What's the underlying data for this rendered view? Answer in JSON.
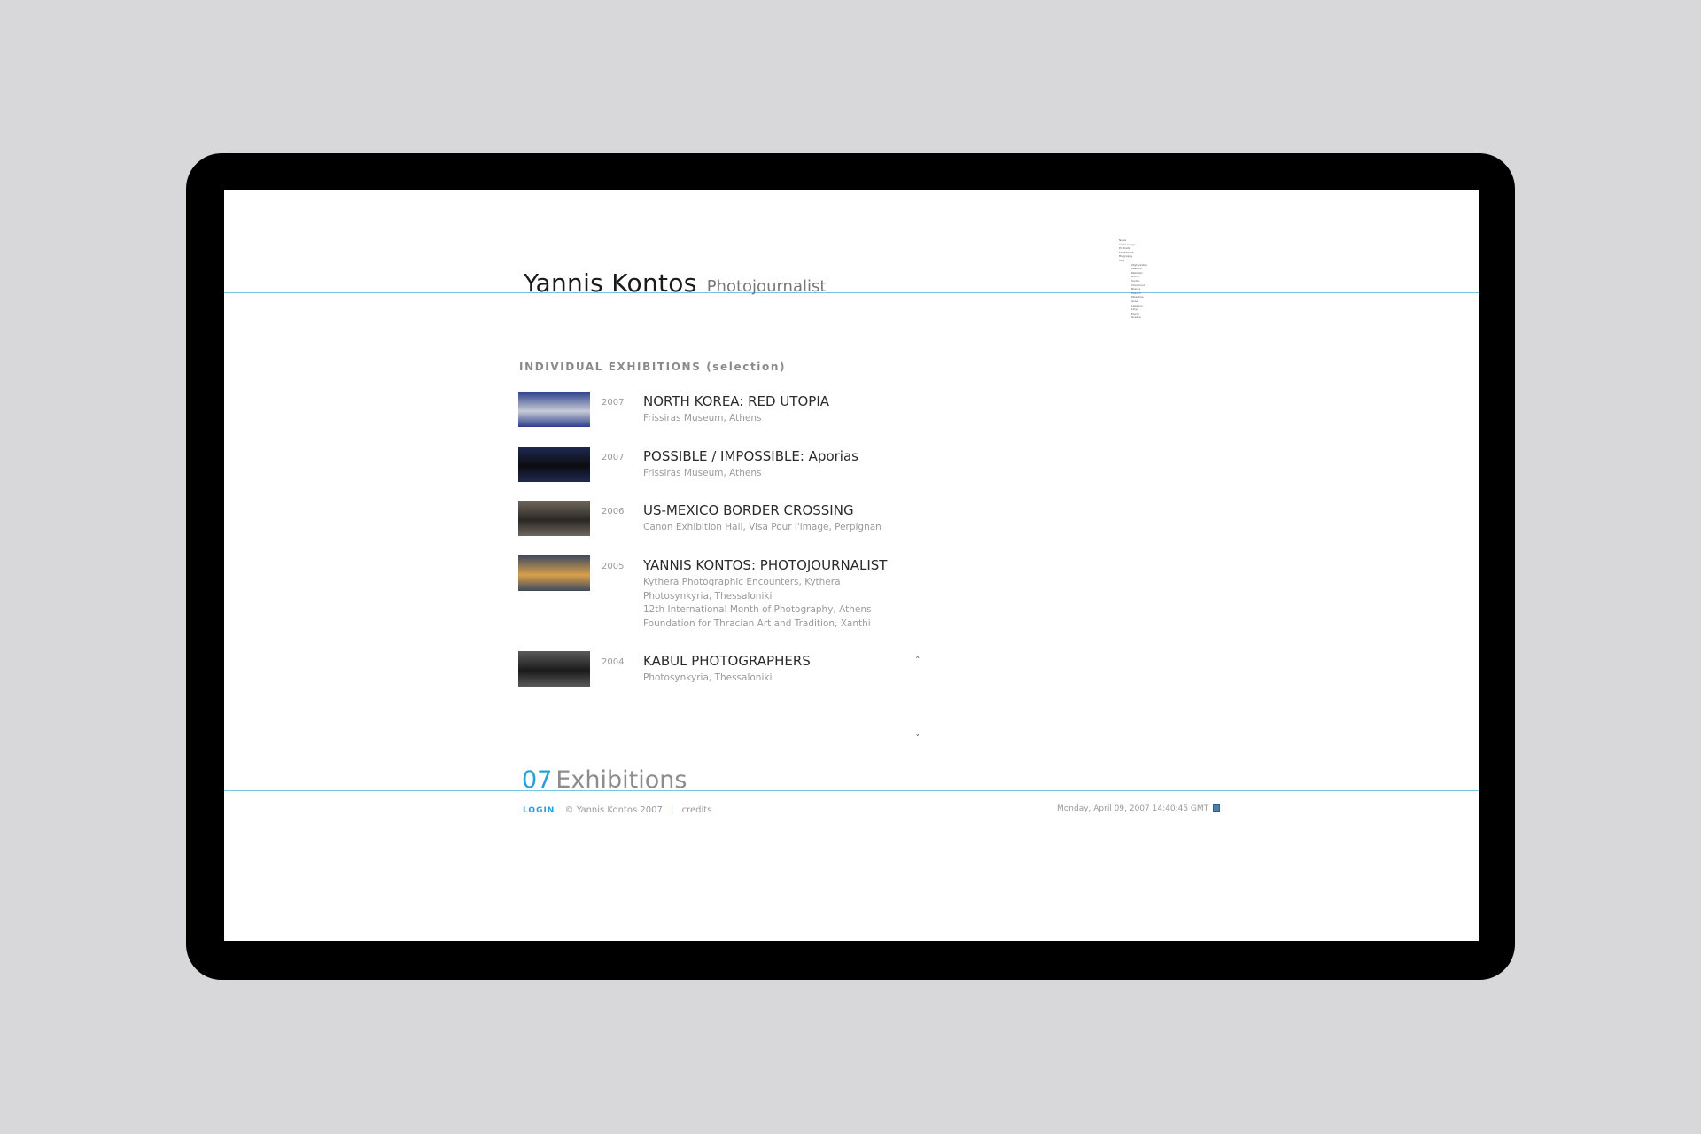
{
  "header": {
    "name": "Yannis Kontos",
    "role": "Photojournalist"
  },
  "nav": {
    "items": [
      "News",
      "Index Image",
      "Portraits",
      "Exhibitions",
      "Biography",
      "Iraq",
      "Afghanistan",
      "Kashmir",
      "Pakistan",
      "Africa",
      "Sudan",
      "Chechnya",
      "Bosnia",
      "Kosovo",
      "Palestine",
      "Israel",
      "Lebanon",
      "Libya",
      "Egypt",
      "Greece"
    ]
  },
  "section": {
    "heading": "INDIVIDUAL EXHIBITIONS (selection)"
  },
  "exhibitions": [
    {
      "year": "2007",
      "title": "NORTH KOREA: RED UTOPIA",
      "venues": [
        "Frissiras Museum, Athens"
      ],
      "thumb_colors": [
        "#2b3e8c",
        "#c8ccd6"
      ]
    },
    {
      "year": "2007",
      "title": "POSSIBLE / IMPOSSIBLE: Aporias",
      "venues": [
        "Frissiras Museum, Athens"
      ],
      "thumb_colors": [
        "#1e2a52",
        "#0c0c10"
      ]
    },
    {
      "year": "2006",
      "title": "US-MEXICO BORDER CROSSING",
      "venues": [
        "Canon Exhibition Hall, Visa Pour l'image, Perpignan"
      ],
      "thumb_colors": [
        "#6e675e",
        "#2a2723"
      ]
    },
    {
      "year": "2005",
      "title": "YANNIS KONTOS: PHOTOJOURNALIST",
      "venues": [
        "Kythera Photographic Encounters, Kythera",
        "Photosynkyria, Thessaloniki",
        "12th International Month of Photography, Athens",
        "Foundation for Thracian Art and Tradition, Xanthi"
      ],
      "thumb_colors": [
        "#3f4a5e",
        "#d9a04a"
      ]
    },
    {
      "year": "2004",
      "title": "KABUL PHOTOGRAPHERS",
      "venues": [
        "Photosynkyria, Thessaloniki"
      ],
      "thumb_colors": [
        "#5a5a5a",
        "#1a1a1a"
      ]
    }
  ],
  "scroll": {
    "up": "˄",
    "down": "˅"
  },
  "page_heading": {
    "number": "07",
    "label": "Exhibitions"
  },
  "footer": {
    "login": "LOGIN",
    "copyright": "© Yannis Kontos 2007",
    "separator": "|",
    "credits": "credits",
    "datetime": "Monday, April 09, 2007 14:40:45 GMT"
  },
  "colors": {
    "accent": "#2a9fd6",
    "rule": "#7cc3e2",
    "background": "#d8d8da",
    "device": "#000000"
  }
}
